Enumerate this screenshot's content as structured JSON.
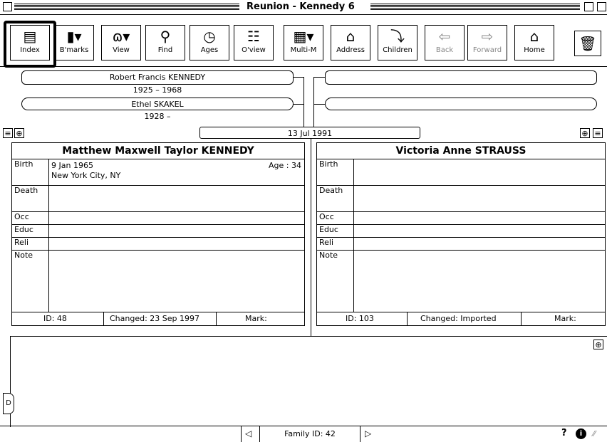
{
  "window": {
    "title": "Reunion - Kennedy 6"
  },
  "toolbar": {
    "buttons": [
      {
        "label": "Index",
        "icon": "index-cards-icon"
      },
      {
        "label": "B'marks",
        "icon": "bookmark-icon"
      },
      {
        "label": "View",
        "icon": "glasses-icon"
      },
      {
        "label": "Find",
        "icon": "magnifier-icon"
      },
      {
        "label": "Ages",
        "icon": "clock-icon"
      },
      {
        "label": "O'view",
        "icon": "tree-icon"
      },
      {
        "label": "Multi-M",
        "icon": "multimedia-icon"
      },
      {
        "label": "Address",
        "icon": "house-outline-icon"
      },
      {
        "label": "Children",
        "icon": "children-icon"
      },
      {
        "label": "Back",
        "icon": "back-arrow-icon"
      },
      {
        "label": "Forward",
        "icon": "forward-arrow-icon"
      },
      {
        "label": "Home",
        "icon": "home-icon"
      }
    ]
  },
  "parents_left": {
    "father_name": "Robert Francis KENNEDY",
    "father_dates": "1925 – 1968",
    "mother_name": "Ethel SKAKEL",
    "mother_dates": "1928 –"
  },
  "marriage_date": "13 Jul 1991",
  "husband": {
    "name": "Matthew Maxwell Taylor KENNEDY",
    "birth_date": "9 Jan 1965",
    "age": "Age : 34",
    "birth_place": "New York City, NY",
    "labels": {
      "birth": "Birth",
      "death": "Death",
      "occ": "Occ",
      "educ": "Educ",
      "reli": "Reli",
      "note": "Note"
    },
    "id": "ID: 48",
    "changed": "Changed: 23 Sep 1997",
    "mark": "Mark:"
  },
  "wife": {
    "name": "Victoria Anne STRAUSS",
    "labels": {
      "birth": "Birth",
      "death": "Death",
      "occ": "Occ",
      "educ": "Educ",
      "reli": "Reli",
      "note": "Note"
    },
    "id": "ID: 103",
    "changed": "Changed: Imported",
    "mark": "Mark:"
  },
  "status": {
    "family_id": "Family ID: 42",
    "help": "?"
  }
}
